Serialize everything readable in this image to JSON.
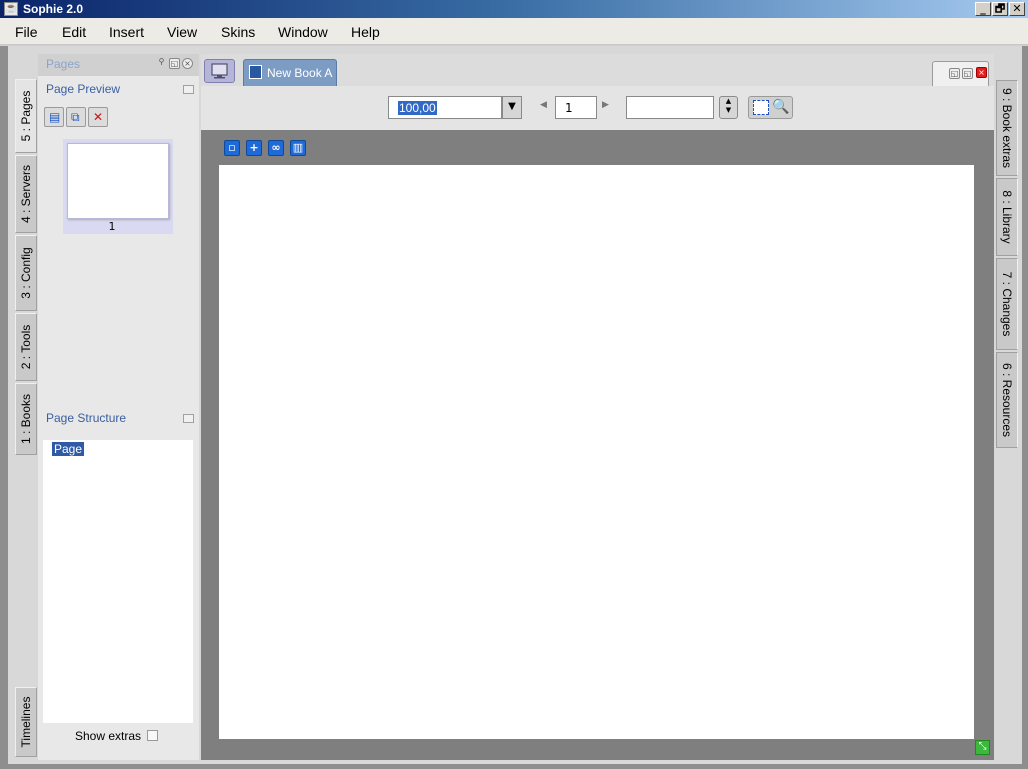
{
  "window": {
    "title": "Sophie 2.0",
    "controls": [
      "_",
      "🗗",
      "✕"
    ]
  },
  "menu": [
    "File",
    "Edit",
    "Insert",
    "View",
    "Skins",
    "Window",
    "Help"
  ],
  "left_tabs": [
    "5 : Pages",
    "4 : Servers",
    "3 : Config",
    "2 : Tools",
    "1 : Books",
    "Timelines"
  ],
  "right_tabs": [
    "9 : Book extras",
    "8 : Library",
    "7 : Changes",
    "6 : Resources"
  ],
  "pages_panel": {
    "header": "Pages",
    "preview_title": "Page Preview",
    "page_number": "1",
    "structure_title": "Page Structure",
    "structure_item": "Page",
    "show_extras_label": "Show extras"
  },
  "document": {
    "tab_label": "New Book A",
    "zoom_value": "100,00",
    "page_value": "1"
  },
  "colors": {
    "accent": "#3169c6",
    "section_title": "#3a5fa0",
    "workspace_bg": "#7f7f7f",
    "resize_handle": "#3cb83c"
  }
}
